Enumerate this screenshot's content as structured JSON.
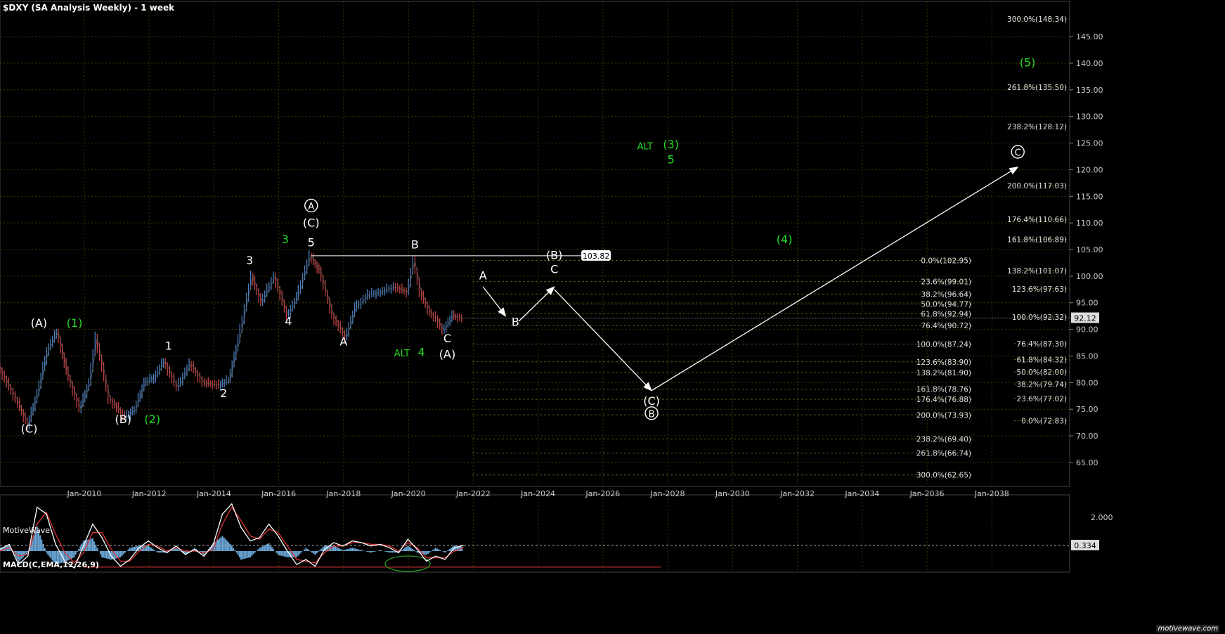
{
  "chart_title": "$DXY (SA Analysis Weekly) - 1 week",
  "watermark": "MotiveWave",
  "macd_title": "MACD(C,EMA,12,26,9)",
  "brand": "motivewave.com",
  "colors": {
    "background": "#000000",
    "grid": "#3a3a00",
    "fib": "#5a5a1a",
    "up_bar": "#4a7fbf",
    "down_bar": "#c04040",
    "label_white": "#ffffff",
    "label_green": "#22dd22",
    "macd_hist": "#6aa6d6",
    "macd_line": "#ffffff",
    "signal_line": "#dd3333"
  },
  "chart_data": {
    "type": "line",
    "x_ticks": [
      "Jan-2010",
      "Jan-2012",
      "Jan-2014",
      "Jan-2016",
      "Jan-2018",
      "Jan-2020",
      "Jan-2022",
      "Jan-2024",
      "Jan-2026",
      "Jan-2028",
      "Jan-2030",
      "Jan-2032",
      "Jan-2034",
      "Jan-2036",
      "Jan-2038"
    ],
    "y_ticks": [
      145,
      140,
      135,
      130,
      125,
      120,
      115,
      110,
      105,
      100,
      95,
      90,
      85,
      80,
      75,
      70,
      65
    ],
    "ylim": [
      60.5,
      149.5
    ],
    "xlim": [
      2007.4,
      2040.4
    ],
    "price_series": [
      {
        "x": 2007.4,
        "y": 83.0
      },
      {
        "x": 2008.0,
        "y": 76.0
      },
      {
        "x": 2008.3,
        "y": 72.0
      },
      {
        "x": 2008.6,
        "y": 78.0
      },
      {
        "x": 2008.9,
        "y": 86.0
      },
      {
        "x": 2009.2,
        "y": 89.5
      },
      {
        "x": 2009.5,
        "y": 82.0
      },
      {
        "x": 2009.9,
        "y": 75.0
      },
      {
        "x": 2010.2,
        "y": 80.0
      },
      {
        "x": 2010.4,
        "y": 88.5
      },
      {
        "x": 2010.8,
        "y": 77.0
      },
      {
        "x": 2011.3,
        "y": 73.5
      },
      {
        "x": 2011.6,
        "y": 75.0
      },
      {
        "x": 2011.9,
        "y": 80.0
      },
      {
        "x": 2012.2,
        "y": 81.0
      },
      {
        "x": 2012.5,
        "y": 84.0
      },
      {
        "x": 2012.9,
        "y": 79.0
      },
      {
        "x": 2013.3,
        "y": 83.5
      },
      {
        "x": 2013.7,
        "y": 80.0
      },
      {
        "x": 2014.2,
        "y": 79.5
      },
      {
        "x": 2014.5,
        "y": 80.5
      },
      {
        "x": 2014.8,
        "y": 88.0
      },
      {
        "x": 2015.2,
        "y": 100.0
      },
      {
        "x": 2015.5,
        "y": 95.0
      },
      {
        "x": 2015.9,
        "y": 100.0
      },
      {
        "x": 2016.3,
        "y": 92.5
      },
      {
        "x": 2016.6,
        "y": 96.0
      },
      {
        "x": 2017.0,
        "y": 103.8
      },
      {
        "x": 2017.3,
        "y": 101.0
      },
      {
        "x": 2017.7,
        "y": 92.5
      },
      {
        "x": 2018.1,
        "y": 88.5
      },
      {
        "x": 2018.4,
        "y": 94.0
      },
      {
        "x": 2018.8,
        "y": 96.5
      },
      {
        "x": 2019.2,
        "y": 97.0
      },
      {
        "x": 2019.6,
        "y": 98.0
      },
      {
        "x": 2020.0,
        "y": 97.0
      },
      {
        "x": 2020.2,
        "y": 102.9
      },
      {
        "x": 2020.4,
        "y": 97.0
      },
      {
        "x": 2020.7,
        "y": 93.0
      },
      {
        "x": 2020.9,
        "y": 92.0
      },
      {
        "x": 2021.1,
        "y": 89.8
      },
      {
        "x": 2021.4,
        "y": 92.5
      },
      {
        "x": 2021.7,
        "y": 92.1
      }
    ],
    "projection_paths": [
      [
        {
          "x": 2022.3,
          "y": 98.0
        },
        {
          "x": 2023.0,
          "y": 92.5
        }
      ],
      [
        {
          "x": 2023.4,
          "y": 91.5
        },
        {
          "x": 2024.5,
          "y": 98.0
        }
      ],
      [
        {
          "x": 2024.5,
          "y": 97.5
        },
        {
          "x": 2027.5,
          "y": 78.5
        }
      ],
      [
        {
          "x": 2027.5,
          "y": 78.5
        },
        {
          "x": 2038.8,
          "y": 120.5
        }
      ]
    ],
    "hline": {
      "x1": 2017.0,
      "x2": 2026.2,
      "y": 103.82,
      "label": "103.82"
    },
    "wave_labels": [
      {
        "text": "(C)",
        "x": 2008.3,
        "y": 70.6,
        "color": "white"
      },
      {
        "text": "(A)",
        "x": 2008.6,
        "y": 90.5,
        "color": "white"
      },
      {
        "text": "(1)",
        "x": 2009.7,
        "y": 90.5,
        "color": "green"
      },
      {
        "text": "(B)",
        "x": 2011.2,
        "y": 72.4,
        "color": "white"
      },
      {
        "text": "(2)",
        "x": 2012.1,
        "y": 72.4,
        "color": "green"
      },
      {
        "text": "1",
        "x": 2012.6,
        "y": 86.2,
        "color": "white"
      },
      {
        "text": "2",
        "x": 2014.3,
        "y": 77.3,
        "color": "white"
      },
      {
        "text": "3",
        "x": 2015.1,
        "y": 102.2,
        "color": "white"
      },
      {
        "text": "3",
        "x": 2016.2,
        "y": 106.2,
        "color": "green"
      },
      {
        "text": "4",
        "x": 2016.3,
        "y": 90.8,
        "color": "white"
      },
      {
        "text": "5",
        "x": 2017.0,
        "y": 105.6,
        "color": "white"
      },
      {
        "text": "(C)",
        "x": 2017.0,
        "y": 109.3,
        "color": "white"
      },
      {
        "text": "A",
        "x": 2017.0,
        "y": 112.6,
        "color": "white",
        "circled": true
      },
      {
        "text": "A",
        "x": 2018.0,
        "y": 87.0,
        "color": "white"
      },
      {
        "text": "B",
        "x": 2020.2,
        "y": 105.2,
        "color": "white"
      },
      {
        "text": "ALT",
        "x": 2019.8,
        "y": 84.9,
        "color": "green"
      },
      {
        "text": "4",
        "x": 2020.4,
        "y": 85.0,
        "color": "green"
      },
      {
        "text": "C",
        "x": 2021.2,
        "y": 87.6,
        "color": "white"
      },
      {
        "text": "(A)",
        "x": 2021.2,
        "y": 84.6,
        "color": "white"
      },
      {
        "text": "A",
        "x": 2022.3,
        "y": 99.4,
        "color": "white"
      },
      {
        "text": "B",
        "x": 2023.3,
        "y": 90.7,
        "color": "white"
      },
      {
        "text": "C",
        "x": 2024.5,
        "y": 100.6,
        "color": "white"
      },
      {
        "text": "(B)",
        "x": 2024.5,
        "y": 103.2,
        "color": "white"
      },
      {
        "text": "(C)",
        "x": 2027.5,
        "y": 75.8,
        "color": "white"
      },
      {
        "text": "B",
        "x": 2027.5,
        "y": 73.6,
        "color": "white",
        "circled": true
      },
      {
        "text": "ALT",
        "x": 2027.3,
        "y": 123.8,
        "color": "green"
      },
      {
        "text": "(3)",
        "x": 2028.1,
        "y": 124.0,
        "color": "green"
      },
      {
        "text": "5",
        "x": 2028.1,
        "y": 121.2,
        "color": "green"
      },
      {
        "text": "(4)",
        "x": 2031.6,
        "y": 106.2,
        "color": "green"
      },
      {
        "text": "(5)",
        "x": 2039.1,
        "y": 139.4,
        "color": "green"
      },
      {
        "text": "C",
        "x": 2038.8,
        "y": 122.7,
        "color": "white",
        "circled": true
      }
    ],
    "fib_right": [
      {
        "label": "300.0%(148.34)",
        "y": 148.34
      },
      {
        "label": "261.8%(135.50)",
        "y": 135.5
      },
      {
        "label": "238.2%(128.12)",
        "y": 128.12
      },
      {
        "label": "200.0%(117.03)",
        "y": 117.03
      },
      {
        "label": "176.4%(110.66)",
        "y": 110.66
      },
      {
        "label": "161.8%(106.89)",
        "y": 106.89
      },
      {
        "label": "138.2%(101.07)",
        "y": 101.07
      },
      {
        "label": "123.6%(97.63)",
        "y": 97.63
      },
      {
        "label": "100.0%(92.32)",
        "y": 92.32
      },
      {
        "label": "76.4%(87.30)",
        "y": 87.3
      },
      {
        "label": "61.8%(84.32)",
        "y": 84.32
      },
      {
        "label": "50.0%(82.00)",
        "y": 82.0
      },
      {
        "label": "38.2%(79.74)",
        "y": 79.74
      },
      {
        "label": "23.6%(77.02)",
        "y": 77.02
      },
      {
        "label": "0.0%(72.83)",
        "y": 72.83
      }
    ],
    "fib_mid": [
      {
        "label": "0.0%(102.95)",
        "y": 102.95
      },
      {
        "label": "23.6%(99.01)",
        "y": 99.01
      },
      {
        "label": "38.2%(96.64)",
        "y": 96.64
      },
      {
        "label": "50.0%(94.77)",
        "y": 94.77
      },
      {
        "label": "61.8%(92.94)",
        "y": 92.94
      },
      {
        "label": "76.4%(90.72)",
        "y": 90.72
      },
      {
        "label": "100.0%(87.24)",
        "y": 87.24
      },
      {
        "label": "123.6%(83.90)",
        "y": 83.9
      },
      {
        "label": "138.2%(81.90)",
        "y": 81.9
      },
      {
        "label": "161.8%(78.76)",
        "y": 78.76
      },
      {
        "label": "176.4%(76.88)",
        "y": 76.88
      },
      {
        "label": "200.0%(73.93)",
        "y": 73.93
      },
      {
        "label": "238.2%(69.40)",
        "y": 69.4
      },
      {
        "label": "261.8%(66.74)",
        "y": 66.74
      },
      {
        "label": "300.0%(62.65)",
        "y": 62.65
      }
    ],
    "last_price": {
      "y": 92.12,
      "label": "92.12"
    },
    "macd": {
      "ylim": [
        -1.0,
        3.0
      ],
      "y_ticks": [
        {
          "v": 2.0,
          "label": "2.000"
        }
      ],
      "last_value": {
        "v": 0.334,
        "label": "0.334"
      },
      "line": [
        0.1,
        0.4,
        -0.8,
        -0.3,
        2.6,
        2.2,
        0.4,
        -0.6,
        -1.0,
        0.3,
        1.6,
        0.8,
        -0.3,
        -0.9,
        -0.5,
        0.2,
        0.6,
        0.2,
        -0.1,
        0.3,
        -0.2,
        0.1,
        -0.3,
        0.4,
        2.2,
        2.8,
        1.4,
        0.6,
        0.8,
        1.6,
        0.9,
        0.0,
        -0.8,
        -0.5,
        -0.9,
        0.1,
        0.5,
        0.3,
        0.6,
        0.5,
        0.3,
        0.4,
        0.2,
        -0.1,
        0.7,
        0.1,
        -0.6,
        -0.3,
        -0.5,
        0.2,
        0.33
      ],
      "signal": [
        0.0,
        0.2,
        -0.3,
        -0.2,
        1.6,
        2.3,
        1.0,
        -0.1,
        -0.7,
        -0.1,
        1.1,
        1.1,
        0.1,
        -0.6,
        -0.6,
        0.0,
        0.4,
        0.3,
        0.0,
        0.2,
        0.0,
        0.0,
        -0.1,
        0.1,
        1.6,
        2.6,
        1.8,
        0.9,
        0.7,
        1.3,
        1.1,
        0.3,
        -0.5,
        -0.6,
        -0.7,
        -0.1,
        0.3,
        0.3,
        0.5,
        0.5,
        0.4,
        0.4,
        0.3,
        0.0,
        0.5,
        0.2,
        -0.4,
        -0.4,
        -0.4,
        0.0,
        0.2
      ],
      "support_level": -0.95
    }
  }
}
